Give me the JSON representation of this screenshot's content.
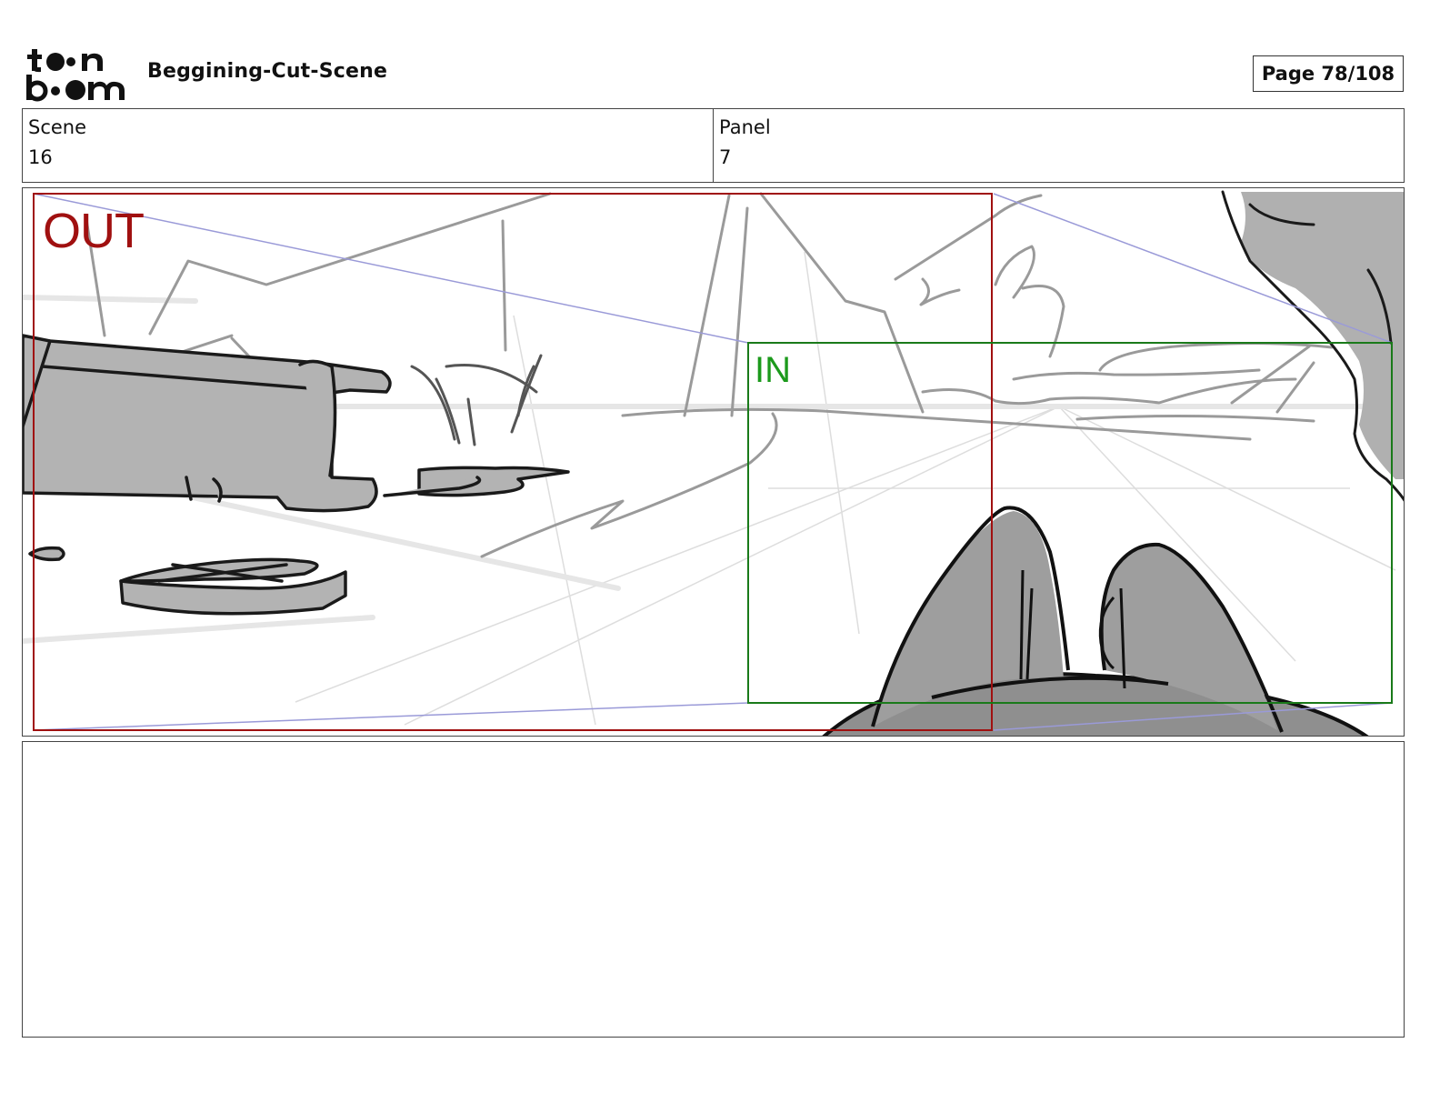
{
  "header": {
    "logo_text": "toon boom",
    "title": "Beggining-Cut-Scene",
    "page_label": "Page",
    "page_number": "78/108"
  },
  "info": {
    "scene_label": "Scene",
    "scene_value": "16",
    "panel_label": "Panel",
    "panel_value": "7"
  },
  "camera": {
    "out_label": "OUT",
    "in_label": "IN",
    "out_color": "#a01010",
    "in_color": "#1c9a1c",
    "path_color": "#9a9ad8"
  },
  "notes": {
    "text": ""
  }
}
